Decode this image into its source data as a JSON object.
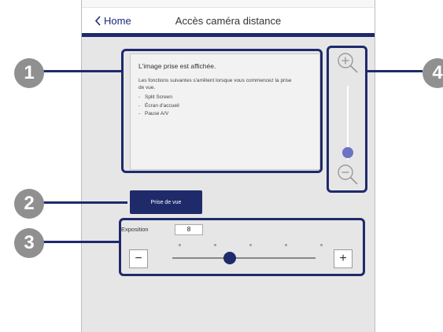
{
  "header": {
    "back_label": "Home",
    "title": "Accès caméra distance"
  },
  "info_panel": {
    "title": "L'image prise est affichée.",
    "description": "Les fonctions suivantes s'arrêtent lorsque vous commencez la prise de vue.",
    "items": [
      "Split Screen",
      "Écran d'accueil",
      "Pause A/V"
    ]
  },
  "capture_button": {
    "label": "Prise de vue"
  },
  "exposure": {
    "label": "Exposition",
    "value": "8",
    "minus_symbol": "−",
    "plus_symbol": "+",
    "slider_level": 0.4
  },
  "zoom": {
    "in_icon": "zoom-in-magnifier",
    "out_icon": "zoom-out-magnifier",
    "level": 0.1
  },
  "callouts": [
    "1",
    "2",
    "3",
    "4"
  ],
  "colors": {
    "accent": "#1f2a6b",
    "callout_grey": "#909090",
    "panel_background": "#e6e6e6",
    "slider_thumb_light": "#6c72c4"
  }
}
